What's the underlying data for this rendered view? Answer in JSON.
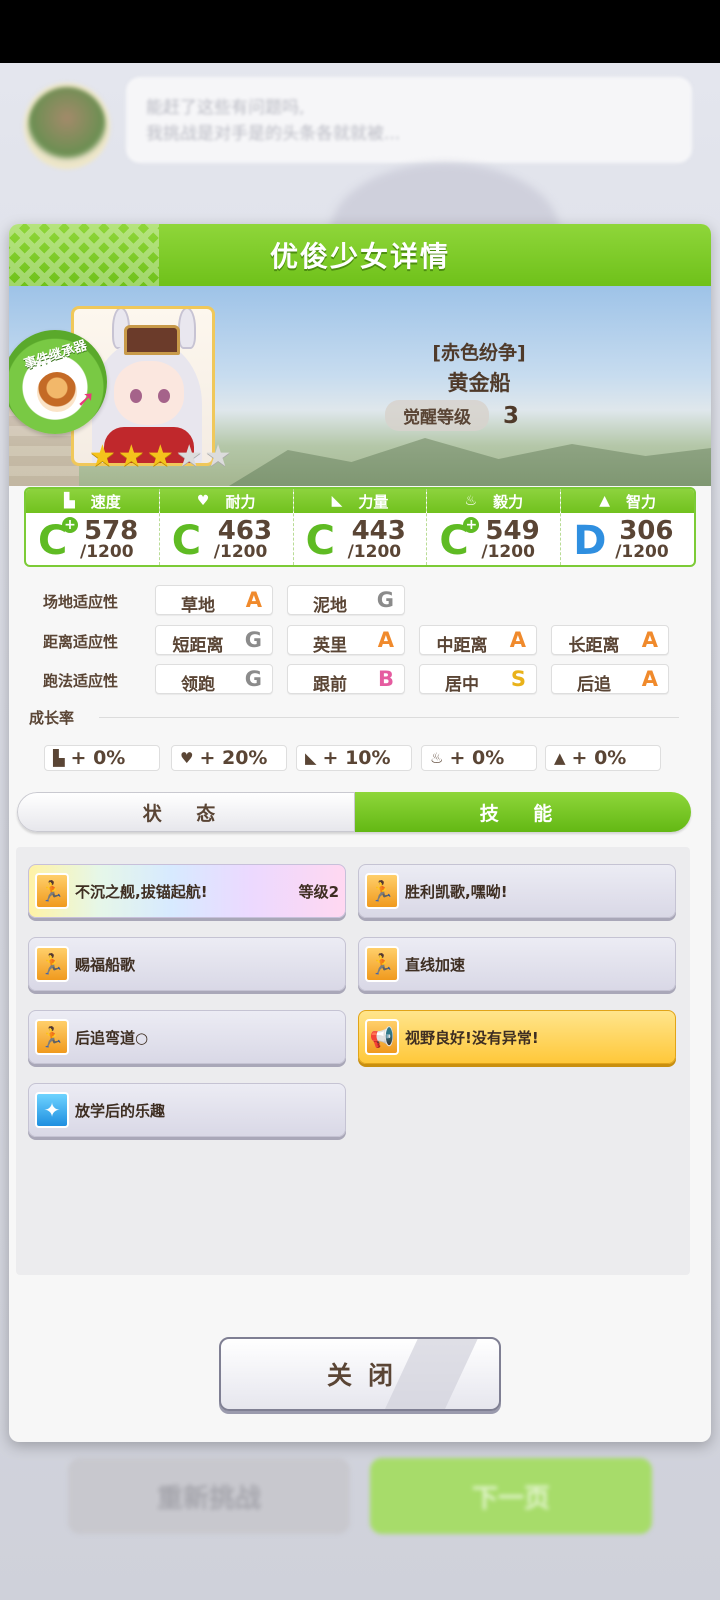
{
  "background": {
    "speech_lines": [
      "能赶了这些有问题吗,",
      "我挑战是对手是的头条各就就被..."
    ],
    "retry_label": "重新挑战",
    "next_label": "下一页"
  },
  "dialog": {
    "title": "优俊少女详情",
    "badge_text": "事件继承器",
    "epithet": "[赤色纷争]",
    "name": "黄金船",
    "awaken_label": "觉醒等级",
    "awaken_level": "3",
    "stars": {
      "filled": 3,
      "total": 5
    }
  },
  "stats": [
    {
      "name": "速度",
      "icon": "shoe-icon",
      "rank": "C",
      "plus": true,
      "value": "578",
      "max": "/1200"
    },
    {
      "name": "耐力",
      "icon": "heart-icon",
      "rank": "C",
      "plus": false,
      "value": "463",
      "max": "/1200"
    },
    {
      "name": "力量",
      "icon": "muscle-icon",
      "rank": "C",
      "plus": false,
      "value": "443",
      "max": "/1200"
    },
    {
      "name": "毅力",
      "icon": "flame-icon",
      "rank": "C",
      "plus": true,
      "value": "549",
      "max": "/1200"
    },
    {
      "name": "智力",
      "icon": "graduation-cap-icon",
      "rank": "D",
      "plus": false,
      "value": "306",
      "max": "/1200"
    }
  ],
  "aptitude": {
    "track": {
      "label": "场地适应性",
      "items": [
        {
          "name": "草地",
          "grade": "A"
        },
        {
          "name": "泥地",
          "grade": "G"
        }
      ]
    },
    "distance": {
      "label": "距离适应性",
      "items": [
        {
          "name": "短距离",
          "grade": "G"
        },
        {
          "name": "英里",
          "grade": "A"
        },
        {
          "name": "中距离",
          "grade": "A"
        },
        {
          "name": "长距离",
          "grade": "A"
        }
      ]
    },
    "style": {
      "label": "跑法适应性",
      "items": [
        {
          "name": "领跑",
          "grade": "G"
        },
        {
          "name": "跟前",
          "grade": "B"
        },
        {
          "name": "居中",
          "grade": "S"
        },
        {
          "name": "后追",
          "grade": "A"
        }
      ]
    }
  },
  "growth": {
    "title": "成长率",
    "items": [
      "+ 0%",
      "+ 20%",
      "+ 10%",
      "+ 0%",
      "+ 0%"
    ]
  },
  "tabs": {
    "status": "状 态",
    "skills": "技 能",
    "active": "skills"
  },
  "skills": [
    {
      "name": "不沉之舰,拔锚起航!",
      "level": "等级2",
      "style": "rainbow",
      "icon": "running-icon"
    },
    {
      "name": "胜利凯歌,嘿呦!",
      "level": "",
      "style": "normal",
      "icon": "running-icon"
    },
    {
      "name": "赐福船歌",
      "level": "",
      "style": "normal",
      "icon": "running-icon"
    },
    {
      "name": "直线加速",
      "level": "",
      "style": "normal",
      "icon": "running-icon"
    },
    {
      "name": "后追弯道○",
      "level": "",
      "style": "normal",
      "icon": "running-icon"
    },
    {
      "name": "视野良好!没有异常!",
      "level": "",
      "style": "gold",
      "icon": "megaphone-icon"
    },
    {
      "name": "放学后的乐趣",
      "level": "",
      "style": "normal",
      "icon": "sparkle-icon"
    }
  ],
  "close_label": "关闭"
}
